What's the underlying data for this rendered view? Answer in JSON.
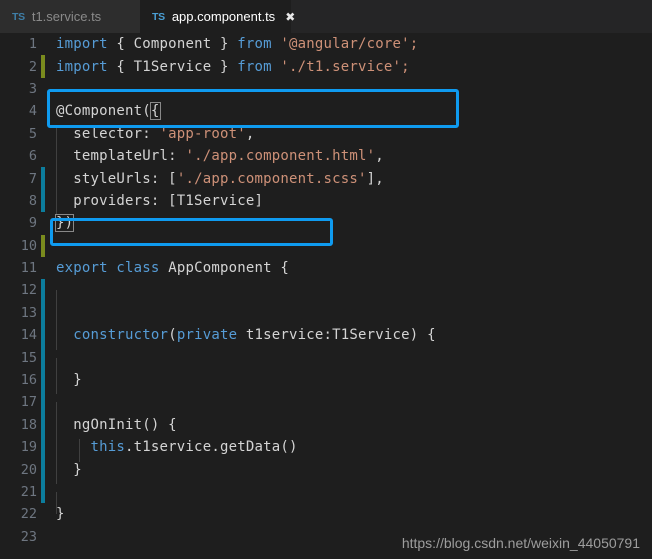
{
  "window": {
    "title": "app.component.ts",
    "theme_bg": "#1e1e1e",
    "accent": "#0f9bf0"
  },
  "tabbar": {
    "tabs": [
      {
        "icon_label": "TS",
        "icon_name": "typescript-file-icon",
        "label": "t1.service.ts",
        "active": false,
        "close_glyph": ""
      },
      {
        "icon_label": "TS",
        "icon_name": "typescript-file-icon",
        "label": "app.component.ts",
        "active": true,
        "close_glyph": "✖"
      }
    ]
  },
  "editor": {
    "language": "typescript",
    "line_numbers": [
      "1",
      "2",
      "3",
      "4",
      "5",
      "6",
      "7",
      "8",
      "9",
      "10",
      "11",
      "12",
      "13",
      "14",
      "15",
      "16",
      "17",
      "18",
      "19",
      "20",
      "21",
      "22",
      "23"
    ],
    "lines": [
      {
        "n": "1",
        "gutter": "none",
        "text": "import { Component } from '@angular/core';"
      },
      {
        "n": "2",
        "gutter": "added",
        "text": "import { T1Service } from './t1.service';"
      },
      {
        "n": "3",
        "gutter": "none",
        "text": ""
      },
      {
        "n": "4",
        "gutter": "none",
        "text": "@Component({"
      },
      {
        "n": "5",
        "gutter": "none",
        "text": "  selector: 'app-root',"
      },
      {
        "n": "6",
        "gutter": "none",
        "text": "  templateUrl: './app.component.html',"
      },
      {
        "n": "7",
        "gutter": "modified",
        "text": "  styleUrls: ['./app.component.scss'],"
      },
      {
        "n": "8",
        "gutter": "modified",
        "text": "  providers: [T1Service]"
      },
      {
        "n": "9",
        "gutter": "none",
        "text": "})"
      },
      {
        "n": "10",
        "gutter": "added",
        "text": ""
      },
      {
        "n": "11",
        "gutter": "none",
        "text": "export class AppComponent {"
      },
      {
        "n": "12",
        "gutter": "modified",
        "text": ""
      },
      {
        "n": "13",
        "gutter": "modified",
        "text": ""
      },
      {
        "n": "14",
        "gutter": "modified",
        "text": "  constructor(private t1service:T1Service) {"
      },
      {
        "n": "15",
        "gutter": "modified",
        "text": ""
      },
      {
        "n": "16",
        "gutter": "modified",
        "text": "  }"
      },
      {
        "n": "17",
        "gutter": "modified",
        "text": ""
      },
      {
        "n": "18",
        "gutter": "modified",
        "text": "  ngOnInit() {"
      },
      {
        "n": "19",
        "gutter": "modified",
        "text": "    this.t1service.getData()"
      },
      {
        "n": "20",
        "gutter": "modified",
        "text": "  }"
      },
      {
        "n": "21",
        "gutter": "modified",
        "text": ""
      },
      {
        "n": "22",
        "gutter": "none",
        "text": "}"
      },
      {
        "n": "23",
        "gutter": "none",
        "text": ""
      }
    ],
    "tokens": {
      "l1_import": "import",
      "l1_braces_open": " { ",
      "l1_component": "Component",
      "l1_braces_close": " } ",
      "l1_from": "from",
      "l1_module": " '@angular/core';",
      "l2_import": "import",
      "l2_braces_open": " { ",
      "l2_t1service": "T1Service",
      "l2_braces_close": " } ",
      "l2_from": "from",
      "l2_module": " './t1.service';",
      "l4_decorator": "@Component(",
      "l4_brace": "{",
      "l5_key": "  selector: ",
      "l5_val": "'app-root'",
      "l5_comma": ",",
      "l6_key": "  templateUrl: ",
      "l6_val": "'./app.component.html'",
      "l6_comma": ",",
      "l7_key": "  styleUrls: [",
      "l7_val": "'./app.component.scss'",
      "l7_end": "],",
      "l8_key": "  providers: [T1Service]",
      "l9_close": "})",
      "l11_export": "export",
      "l11_class": " class",
      "l11_name": " AppComponent {",
      "l14_ctor": "  constructor",
      "l14_paren": "(",
      "l14_private": "private",
      "l14_param": " t1service:T1Service) {",
      "l16_close": "  }",
      "l18_hook": "  ngOnInit() {",
      "l19_indent": "    ",
      "l19_this": "this",
      "l19_call": ".t1service.getData()",
      "l20_close": "  }",
      "l22_close": "}"
    }
  },
  "annotations": [
    {
      "name": "import-highlight-box",
      "target_line": "2",
      "color": "#0f9bf0"
    },
    {
      "name": "providers-highlight-box",
      "target_line": "8",
      "color": "#0f9bf0"
    }
  ],
  "watermark": {
    "text": "https://blog.csdn.net/weixin_44050791"
  }
}
